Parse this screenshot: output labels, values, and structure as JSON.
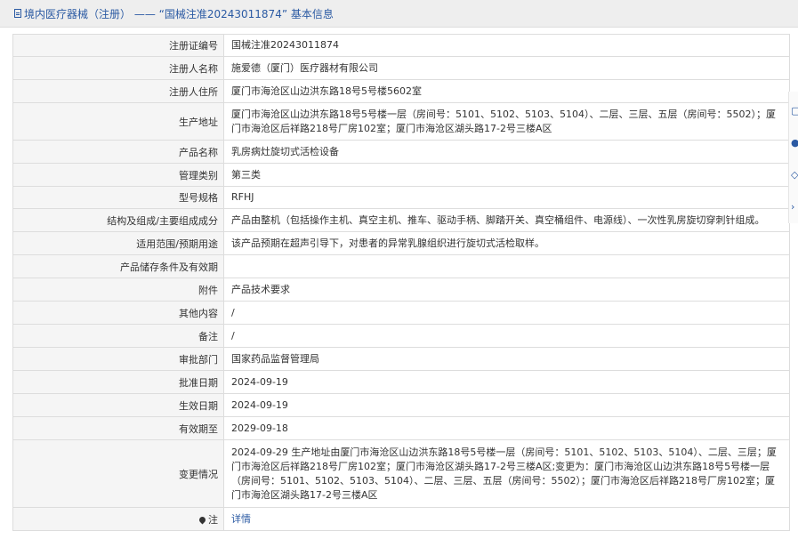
{
  "header": {
    "title": "境内医疗器械（注册） —— “国械注准20243011874” 基本信息",
    "icon": "document-icon"
  },
  "rows": [
    {
      "label": "注册证编号",
      "value": "国械注准20243011874"
    },
    {
      "label": "注册人名称",
      "value": "施爱德（厦门）医疗器材有限公司"
    },
    {
      "label": "注册人住所",
      "value": "厦门市海沧区山边洪东路18号5号楼5602室"
    },
    {
      "label": "生产地址",
      "value": "厦门市海沧区山边洪东路18号5号楼一层（房间号：5101、5102、5103、5104）、二层、三层、五层（房间号：5502）；厦门市海沧区后祥路218号厂房102室；厦门市海沧区湖头路17-2号三楼A区"
    },
    {
      "label": "产品名称",
      "value": "乳房病灶旋切式活检设备"
    },
    {
      "label": "管理类别",
      "value": "第三类"
    },
    {
      "label": "型号规格",
      "value": "RFHJ"
    },
    {
      "label": "结构及组成/主要组成成分",
      "value": "产品由整机（包括操作主机、真空主机、推车、驱动手柄、脚踏开关、真空桶组件、电源线）、一次性乳房旋切穿刺针组成。"
    },
    {
      "label": "适用范围/预期用途",
      "value": "该产品预期在超声引导下，对患者的异常乳腺组织进行旋切式活检取样。"
    },
    {
      "label": "产品储存条件及有效期",
      "value": ""
    },
    {
      "label": "附件",
      "value": "产品技术要求"
    },
    {
      "label": "其他内容",
      "value": "/"
    },
    {
      "label": "备注",
      "value": "/"
    },
    {
      "label": "审批部门",
      "value": "国家药品监督管理局"
    },
    {
      "label": "批准日期",
      "value": "2024-09-19"
    },
    {
      "label": "生效日期",
      "value": "2024-09-19"
    },
    {
      "label": "有效期至",
      "value": "2029-09-18"
    },
    {
      "label": "变更情况",
      "value": "2024-09-29 生产地址由厦门市海沧区山边洪东路18号5号楼一层（房间号：5101、5102、5103、5104）、二层、三层；厦门市海沧区后祥路218号厂房102室；厦门市海沧区湖头路17-2号三楼A区;变更为：厦门市海沧区山边洪东路18号5号楼一层（房间号：5101、5102、5103、5104）、二层、三层、五层（房间号：5502）；厦门市海沧区后祥路218号厂房102室；厦门市海沧区湖头路17-2号三楼A区"
    }
  ],
  "note_row": {
    "label": "注",
    "link_text": "详情"
  },
  "colors": {
    "accent": "#2b5aa3",
    "label_bg": "#f5f5f5",
    "border": "#dddddd"
  }
}
